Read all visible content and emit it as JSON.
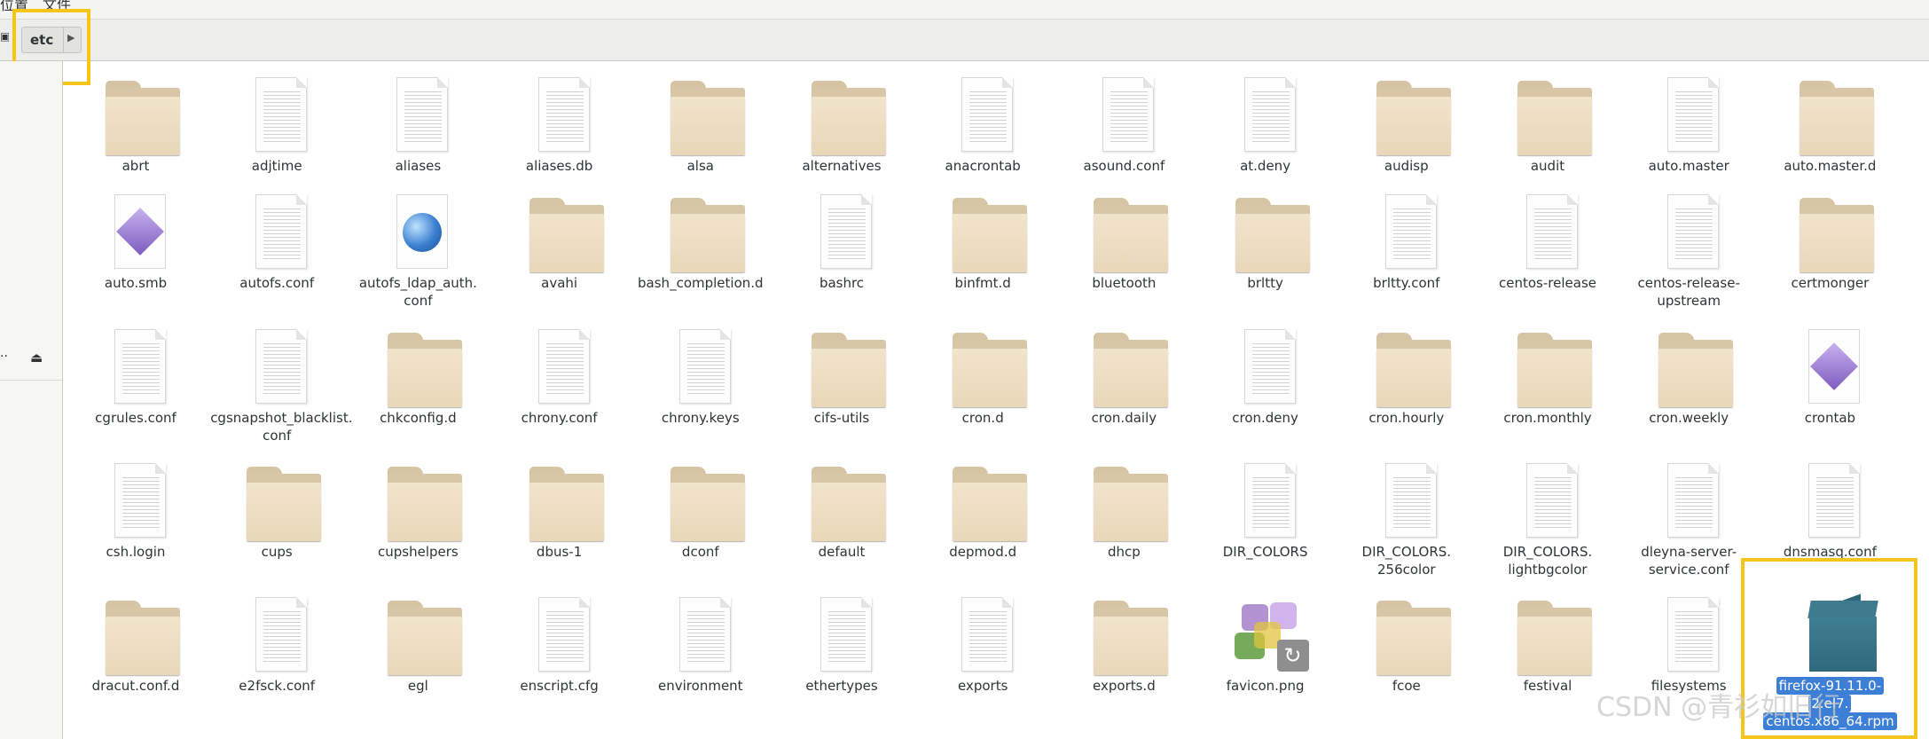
{
  "menubar": {
    "items": [
      "位置",
      "文件"
    ]
  },
  "breadcrumb": {
    "current": "etc"
  },
  "files": [
    {
      "name": "abrt",
      "type": "folder"
    },
    {
      "name": "adjtime",
      "type": "text"
    },
    {
      "name": "aliases",
      "type": "text"
    },
    {
      "name": "aliases.db",
      "type": "text"
    },
    {
      "name": "alsa",
      "type": "folder"
    },
    {
      "name": "alternatives",
      "type": "folder"
    },
    {
      "name": "anacrontab",
      "type": "text"
    },
    {
      "name": "asound.conf",
      "type": "text"
    },
    {
      "name": "at.deny",
      "type": "text"
    },
    {
      "name": "audisp",
      "type": "folder"
    },
    {
      "name": "audit",
      "type": "folder"
    },
    {
      "name": "auto.master",
      "type": "text"
    },
    {
      "name": "auto.master.d",
      "type": "folder"
    },
    {
      "name": "auto.smb",
      "type": "script"
    },
    {
      "name": "autofs.conf",
      "type": "text"
    },
    {
      "name": "autofs_ldap_auth.\nconf",
      "type": "web"
    },
    {
      "name": "avahi",
      "type": "folder"
    },
    {
      "name": "bash_completion.d",
      "type": "folder"
    },
    {
      "name": "bashrc",
      "type": "text"
    },
    {
      "name": "binfmt.d",
      "type": "folder"
    },
    {
      "name": "bluetooth",
      "type": "folder"
    },
    {
      "name": "brltty",
      "type": "folder"
    },
    {
      "name": "brltty.conf",
      "type": "text"
    },
    {
      "name": "centos-release",
      "type": "text"
    },
    {
      "name": "centos-release-\nupstream",
      "type": "text"
    },
    {
      "name": "certmonger",
      "type": "folder"
    },
    {
      "name": "cgrules.conf",
      "type": "text"
    },
    {
      "name": "cgsnapshot_blacklist.\nconf",
      "type": "text"
    },
    {
      "name": "chkconfig.d",
      "type": "folder"
    },
    {
      "name": "chrony.conf",
      "type": "text"
    },
    {
      "name": "chrony.keys",
      "type": "text"
    },
    {
      "name": "cifs-utils",
      "type": "folder"
    },
    {
      "name": "cron.d",
      "type": "folder"
    },
    {
      "name": "cron.daily",
      "type": "folder"
    },
    {
      "name": "cron.deny",
      "type": "text"
    },
    {
      "name": "cron.hourly",
      "type": "folder"
    },
    {
      "name": "cron.monthly",
      "type": "folder"
    },
    {
      "name": "cron.weekly",
      "type": "folder"
    },
    {
      "name": "crontab",
      "type": "script"
    },
    {
      "name": "csh.login",
      "type": "text"
    },
    {
      "name": "cups",
      "type": "folder"
    },
    {
      "name": "cupshelpers",
      "type": "folder"
    },
    {
      "name": "dbus-1",
      "type": "folder"
    },
    {
      "name": "dconf",
      "type": "folder"
    },
    {
      "name": "default",
      "type": "folder"
    },
    {
      "name": "depmod.d",
      "type": "folder"
    },
    {
      "name": "dhcp",
      "type": "folder"
    },
    {
      "name": "DIR_COLORS",
      "type": "text"
    },
    {
      "name": "DIR_COLORS.\n256color",
      "type": "text"
    },
    {
      "name": "DIR_COLORS.\nlightbgcolor",
      "type": "text"
    },
    {
      "name": "dleyna-server-\nservice.conf",
      "type": "text"
    },
    {
      "name": "dnsmasq.conf",
      "type": "text"
    },
    {
      "name": "dracut.conf.d",
      "type": "folder"
    },
    {
      "name": "e2fsck.conf",
      "type": "text"
    },
    {
      "name": "egl",
      "type": "folder"
    },
    {
      "name": "enscript.cfg",
      "type": "text"
    },
    {
      "name": "environment",
      "type": "text"
    },
    {
      "name": "ethertypes",
      "type": "text"
    },
    {
      "name": "exports",
      "type": "text"
    },
    {
      "name": "exports.d",
      "type": "folder"
    },
    {
      "name": "favicon.png",
      "type": "image"
    },
    {
      "name": "fcoe",
      "type": "folder"
    },
    {
      "name": "festival",
      "type": "folder"
    },
    {
      "name": "filesystems",
      "type": "text"
    },
    {
      "name": "firefox-91.11.0-2.el7.\ncentos.x86_64.rpm",
      "type": "package",
      "selected": true
    }
  ],
  "watermark": "CSDN @青衫如旧行"
}
